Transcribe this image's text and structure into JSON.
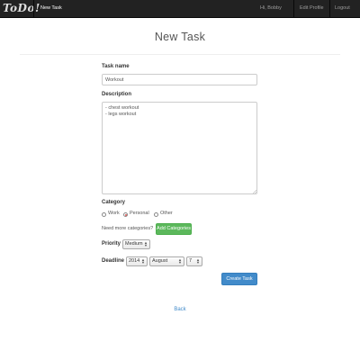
{
  "navbar": {
    "brand": "ToDo!",
    "links": {
      "new_task": "New Task",
      "greeting": "Hi, Bobby",
      "edit_profile": "Edit Profile",
      "logout": "Logout"
    }
  },
  "page": {
    "title": "New Task"
  },
  "form": {
    "task_name": {
      "label": "Task name",
      "value": "Workout"
    },
    "description": {
      "label": "Description",
      "value": "- chest workout\n- legs workout"
    },
    "category": {
      "label": "Category",
      "options": [
        "Work",
        "Personal",
        "Other"
      ],
      "selected": "Personal",
      "more_prompt": "Need more categories?",
      "button_label": "Add Categories"
    },
    "priority": {
      "label": "Priority",
      "value": "Medium"
    },
    "deadline": {
      "label": "Deadline",
      "year": "2014",
      "month": "August",
      "day": "7"
    },
    "submit_label": "Create Task"
  },
  "footer": {
    "back_label": "Back"
  },
  "colors": {
    "navbar_bg": "#222222",
    "primary_button": "#428bca",
    "success_button": "#5cb85c",
    "link": "#428bca",
    "radio_selected": "#d9534f"
  }
}
